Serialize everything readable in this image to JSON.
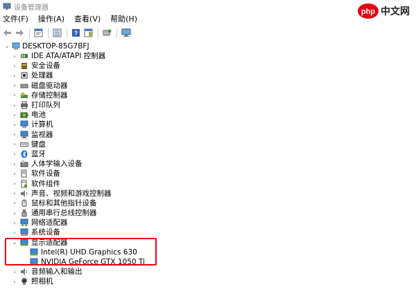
{
  "window": {
    "title": "设备管理器",
    "watermark": "php中文网"
  },
  "menu": {
    "items": [
      "文件(F)",
      "操作(A)",
      "查看(V)",
      "帮助(H)"
    ]
  },
  "tree": {
    "root": "DESKTOP-85G7BFJ",
    "categories": [
      {
        "label": "IDE ATA/ATAPI 控制器",
        "icon": "ide-controller-icon",
        "expanded": false
      },
      {
        "label": "安全设备",
        "icon": "security-device-icon",
        "expanded": false
      },
      {
        "label": "处理器",
        "icon": "processor-icon",
        "expanded": false
      },
      {
        "label": "磁盘驱动器",
        "icon": "disk-drive-icon",
        "expanded": false
      },
      {
        "label": "存储控制器",
        "icon": "storage-controller-icon",
        "expanded": false
      },
      {
        "label": "打印队列",
        "icon": "printer-icon",
        "expanded": false
      },
      {
        "label": "电池",
        "icon": "battery-icon",
        "expanded": false
      },
      {
        "label": "计算机",
        "icon": "computer-icon",
        "expanded": false
      },
      {
        "label": "监视器",
        "icon": "monitor-icon",
        "expanded": false
      },
      {
        "label": "键盘",
        "icon": "keyboard-icon",
        "expanded": false
      },
      {
        "label": "蓝牙",
        "icon": "bluetooth-icon",
        "expanded": false
      },
      {
        "label": "人体学输入设备",
        "icon": "hid-icon",
        "expanded": false
      },
      {
        "label": "软件设备",
        "icon": "software-device-icon",
        "expanded": false
      },
      {
        "label": "软件组件",
        "icon": "software-component-icon",
        "expanded": false
      },
      {
        "label": "声音、视频和游戏控制器",
        "icon": "sound-icon",
        "expanded": false
      },
      {
        "label": "鼠标和其他指针设备",
        "icon": "mouse-icon",
        "expanded": false
      },
      {
        "label": "通用串行总线控制器",
        "icon": "usb-icon",
        "expanded": false
      },
      {
        "label": "网络适配器",
        "icon": "network-adapter-icon",
        "expanded": false
      },
      {
        "label": "系统设备",
        "icon": "system-device-icon",
        "expanded": false
      },
      {
        "label": "显示适配器",
        "icon": "display-adapter-icon",
        "expanded": true,
        "children": [
          "Intel(R) UHD Graphics 630",
          "NVIDIA GeForce GTX 1050 Ti"
        ]
      },
      {
        "label": "音频输入和输出",
        "icon": "audio-io-icon",
        "expanded": false
      },
      {
        "label": "照相机",
        "icon": "camera-icon",
        "expanded": false
      }
    ]
  },
  "colors": {
    "highlight": "#e60012",
    "expander": "#555555",
    "title_text": "#8a8a8a"
  }
}
